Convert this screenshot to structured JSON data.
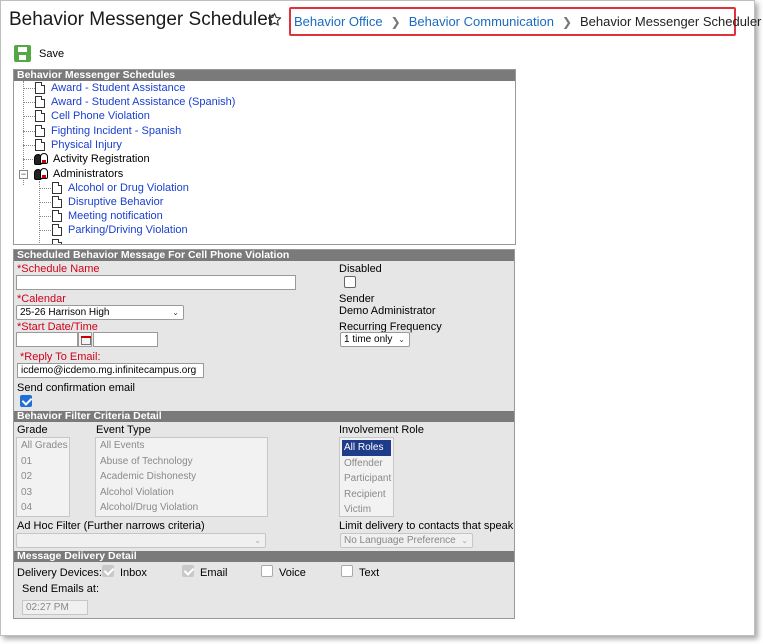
{
  "header": {
    "title": "Behavior Messenger Scheduler",
    "breadcrumbs": [
      {
        "label": "Behavior Office"
      },
      {
        "label": "Behavior Communication"
      },
      {
        "label": "Behavior Messenger Scheduler"
      }
    ]
  },
  "toolbar": {
    "save_label": "Save"
  },
  "schedules": {
    "header": "Behavior Messenger Schedules",
    "items": [
      {
        "label": "Award - Student Assistance"
      },
      {
        "label": "Award - Student Assistance (Spanish)"
      },
      {
        "label": "Cell Phone Violation"
      },
      {
        "label": "Fighting Incident - Spanish"
      },
      {
        "label": "Physical Injury"
      },
      {
        "label": "Activity Registration"
      },
      {
        "label": "Administrators"
      },
      {
        "label": "Alcohol or Drug Violation"
      },
      {
        "label": "Disruptive Behavior"
      },
      {
        "label": "Meeting notification"
      },
      {
        "label": "Parking/Driving Violation"
      }
    ]
  },
  "message": {
    "header": "Scheduled Behavior Message For Cell Phone Violation",
    "schedule_name_label": "*Schedule Name",
    "schedule_name_value": "",
    "calendar_label": "*Calendar",
    "calendar_value": "25-26 Harrison High",
    "start_label": "*Start Date/Time",
    "start_date_value": "",
    "start_time_value": "",
    "reply_label": "*Reply To Email:",
    "reply_value": "icdemo@icdemo.mg.infinitecampus.org",
    "send_confirm_label": "Send confirmation email",
    "send_confirm_checked": true,
    "disabled_label": "Disabled",
    "disabled_checked": false,
    "sender_label": "Sender",
    "sender_value": "Demo Administrator",
    "recurring_label": "Recurring Frequency",
    "recurring_value": "1 time only"
  },
  "filter": {
    "header": "Behavior Filter Criteria Detail",
    "grade_label": "Grade",
    "grades": [
      "All Grades",
      "01",
      "02",
      "03",
      "04"
    ],
    "event_label": "Event Type",
    "events": [
      "All Events",
      "Abuse of Technology",
      "Academic Dishonesty",
      "Alcohol Violation",
      "Alcohol/Drug Violation"
    ],
    "role_label": "Involvement Role",
    "roles": [
      "All Roles",
      "Offender",
      "Participant",
      "Recipient",
      "Victim"
    ],
    "adhoc_label": "Ad Hoc Filter (Further narrows criteria)",
    "adhoc_value": "",
    "language_label": "Limit delivery to contacts that speak",
    "language_value": "No Language Preference"
  },
  "delivery": {
    "header": "Message Delivery Detail",
    "devices_label": "Delivery Devices:",
    "devices": [
      {
        "label": "Inbox",
        "checked": true
      },
      {
        "label": "Email",
        "checked": true
      },
      {
        "label": "Voice",
        "checked": false
      },
      {
        "label": "Text",
        "checked": false
      }
    ],
    "send_emails_label": "Send Emails at:",
    "send_emails_value": "02:27 PM"
  }
}
